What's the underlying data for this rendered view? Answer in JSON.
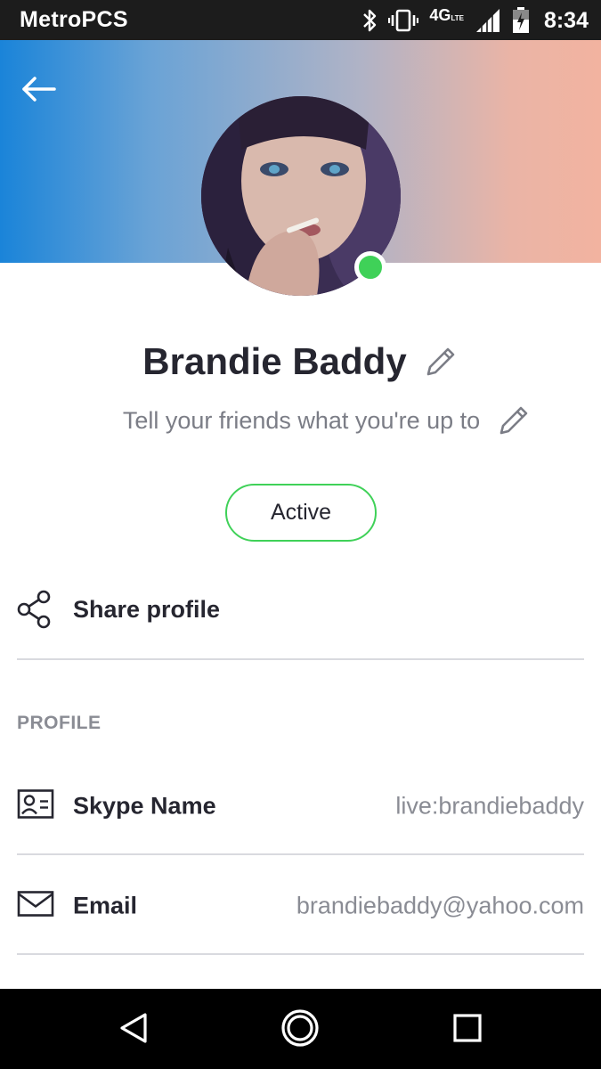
{
  "status_bar": {
    "carrier": "MetroPCS",
    "network": "4G",
    "network_sub": "LTE",
    "time": "8:34",
    "icons": [
      "bluetooth-icon",
      "vibrate-icon",
      "signal-icon",
      "battery-icon"
    ]
  },
  "header": {
    "back_icon": "arrow-left-icon",
    "gradient_start": "#1a84d9",
    "gradient_end": "#f2b3a0"
  },
  "profile": {
    "name": "Brandie Baddy",
    "mood_placeholder": "Tell your friends what you're up to",
    "presence_color": "#3fd158",
    "status_button": "Active"
  },
  "actions": {
    "share_label": "Share profile"
  },
  "section": {
    "title": "PROFILE",
    "rows": [
      {
        "icon": "contact-card-icon",
        "label": "Skype Name",
        "value": "live:brandiebaddy"
      },
      {
        "icon": "mail-icon",
        "label": "Email",
        "value": "brandiebaddy@yahoo.com"
      }
    ]
  },
  "nav_bar": {
    "icons": [
      "back-triangle-icon",
      "home-circle-icon",
      "recents-square-icon"
    ]
  }
}
